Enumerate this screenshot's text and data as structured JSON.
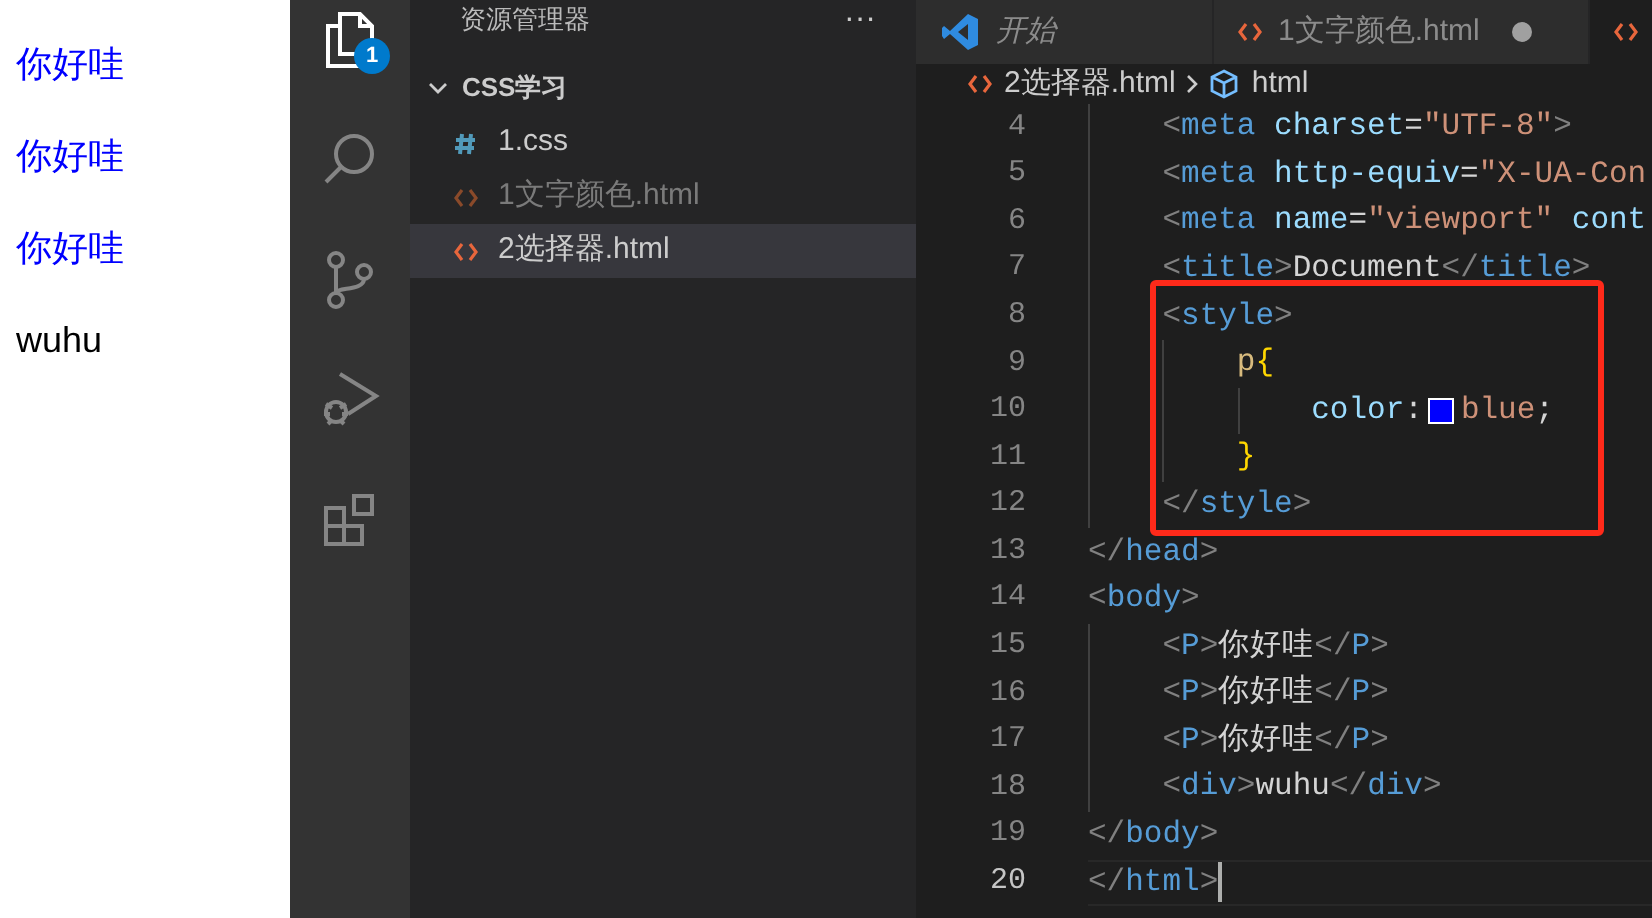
{
  "preview": {
    "items": [
      {
        "kind": "p",
        "text": "你好哇"
      },
      {
        "kind": "p",
        "text": "你好哇"
      },
      {
        "kind": "p",
        "text": "你好哇"
      },
      {
        "kind": "div",
        "text": "wuhu"
      }
    ]
  },
  "activity_bar": {
    "items": [
      {
        "selected": true,
        "badge": "1"
      },
      {
        "selected": false
      },
      {
        "selected": false
      },
      {
        "selected": false
      },
      {
        "selected": false
      }
    ]
  },
  "explorer": {
    "title": "资源管理器",
    "more": "···",
    "folder": {
      "name": "CSS学习",
      "expanded": true,
      "children": [
        {
          "name": "1.css",
          "kind": "css",
          "dimmed": false,
          "selected": false
        },
        {
          "name": "1文字颜色.html",
          "kind": "html",
          "dimmed": true,
          "selected": false
        },
        {
          "name": "2选择器.html",
          "kind": "html",
          "dimmed": false,
          "selected": true
        }
      ]
    }
  },
  "tabs": [
    {
      "kind": "welcome",
      "label": "开始",
      "modified": false,
      "selected": false
    },
    {
      "kind": "html",
      "label": "1文字颜色.html",
      "modified": true,
      "selected": false
    },
    {
      "kind": "html",
      "selected": true,
      "modified": false
    }
  ],
  "breadcrumb": [
    {
      "kind": "html",
      "label": "2选择器.html"
    },
    {
      "kind": "element",
      "label": "html"
    }
  ],
  "editor": {
    "lines": [
      {
        "number": "4",
        "current": false,
        "tokens": [
          {
            "kind": "punct",
            "text": "    <"
          },
          {
            "kind": "tag",
            "text": "meta "
          },
          {
            "kind": "attr",
            "text": "charset"
          },
          {
            "kind": "text",
            "text": "="
          },
          {
            "kind": "string",
            "text": "\"UTF-8\""
          },
          {
            "kind": "punct",
            "text": ">"
          }
        ]
      },
      {
        "number": "5",
        "current": false,
        "tokens": [
          {
            "kind": "punct",
            "text": "    <"
          },
          {
            "kind": "tag",
            "text": "meta "
          },
          {
            "kind": "attr",
            "text": "http-equiv"
          },
          {
            "kind": "text",
            "text": "="
          },
          {
            "kind": "string",
            "text": "\"X-UA-Con"
          }
        ]
      },
      {
        "number": "6",
        "current": false,
        "tokens": [
          {
            "kind": "punct",
            "text": "    <"
          },
          {
            "kind": "tag",
            "text": "meta "
          },
          {
            "kind": "attr",
            "text": "name"
          },
          {
            "kind": "text",
            "text": "="
          },
          {
            "kind": "string",
            "text": "\"viewport\" "
          },
          {
            "kind": "attr",
            "text": "cont"
          }
        ]
      },
      {
        "number": "7",
        "current": false,
        "tokens": [
          {
            "kind": "punct",
            "text": "    <"
          },
          {
            "kind": "tag",
            "text": "title"
          },
          {
            "kind": "punct",
            "text": ">"
          },
          {
            "kind": "text",
            "text": "Document"
          },
          {
            "kind": "punct",
            "text": "</"
          },
          {
            "kind": "tag",
            "text": "title"
          },
          {
            "kind": "punct",
            "text": ">"
          }
        ]
      },
      {
        "number": "8",
        "current": false,
        "tokens": [
          {
            "kind": "punct",
            "text": "    <"
          },
          {
            "kind": "tag",
            "text": "style"
          },
          {
            "kind": "punct",
            "text": ">"
          }
        ]
      },
      {
        "number": "9",
        "current": false,
        "tokens": [
          {
            "kind": "selector",
            "text": "        p"
          },
          {
            "kind": "brace",
            "text": "{"
          }
        ]
      },
      {
        "number": "10",
        "current": false,
        "tokens": [
          {
            "kind": "property",
            "text": "            color"
          },
          {
            "kind": "text",
            "text": ":"
          },
          {
            "kind": "swatch",
            "color": "#0000ff"
          },
          {
            "kind": "value",
            "text": "blue"
          },
          {
            "kind": "text",
            "text": ";"
          }
        ]
      },
      {
        "number": "11",
        "current": false,
        "tokens": [
          {
            "kind": "brace",
            "text": "        }"
          }
        ]
      },
      {
        "number": "12",
        "current": false,
        "tokens": [
          {
            "kind": "punct",
            "text": "    </"
          },
          {
            "kind": "tag",
            "text": "style"
          },
          {
            "kind": "punct",
            "text": ">"
          }
        ]
      },
      {
        "number": "13",
        "current": false,
        "tokens": [
          {
            "kind": "punct",
            "text": "</"
          },
          {
            "kind": "tag",
            "text": "head"
          },
          {
            "kind": "punct",
            "text": ">"
          }
        ]
      },
      {
        "number": "14",
        "current": false,
        "tokens": [
          {
            "kind": "punct",
            "text": "<"
          },
          {
            "kind": "tag",
            "text": "body"
          },
          {
            "kind": "punct",
            "text": ">"
          }
        ]
      },
      {
        "number": "15",
        "current": false,
        "tokens": [
          {
            "kind": "punct",
            "text": "    <"
          },
          {
            "kind": "tag",
            "text": "P"
          },
          {
            "kind": "punct",
            "text": ">"
          },
          {
            "kind": "text",
            "text": "你好哇"
          },
          {
            "kind": "punct",
            "text": "</"
          },
          {
            "kind": "tag",
            "text": "P"
          },
          {
            "kind": "punct",
            "text": ">"
          }
        ]
      },
      {
        "number": "16",
        "current": false,
        "tokens": [
          {
            "kind": "punct",
            "text": "    <"
          },
          {
            "kind": "tag",
            "text": "P"
          },
          {
            "kind": "punct",
            "text": ">"
          },
          {
            "kind": "text",
            "text": "你好哇"
          },
          {
            "kind": "punct",
            "text": "</"
          },
          {
            "kind": "tag",
            "text": "P"
          },
          {
            "kind": "punct",
            "text": ">"
          }
        ]
      },
      {
        "number": "17",
        "current": false,
        "tokens": [
          {
            "kind": "punct",
            "text": "    <"
          },
          {
            "kind": "tag",
            "text": "P"
          },
          {
            "kind": "punct",
            "text": ">"
          },
          {
            "kind": "text",
            "text": "你好哇"
          },
          {
            "kind": "punct",
            "text": "</"
          },
          {
            "kind": "tag",
            "text": "P"
          },
          {
            "kind": "punct",
            "text": ">"
          }
        ]
      },
      {
        "number": "18",
        "current": false,
        "tokens": [
          {
            "kind": "punct",
            "text": "    <"
          },
          {
            "kind": "tag",
            "text": "div"
          },
          {
            "kind": "punct",
            "text": ">"
          },
          {
            "kind": "text",
            "text": "wuhu"
          },
          {
            "kind": "punct",
            "text": "</"
          },
          {
            "kind": "tag",
            "text": "div"
          },
          {
            "kind": "punct",
            "text": ">"
          }
        ]
      },
      {
        "number": "19",
        "current": false,
        "tokens": [
          {
            "kind": "punct",
            "text": "</"
          },
          {
            "kind": "tag",
            "text": "body"
          },
          {
            "kind": "punct",
            "text": ">"
          }
        ]
      },
      {
        "number": "20",
        "current": true,
        "tokens": [
          {
            "kind": "punct",
            "text": "</"
          },
          {
            "kind": "tag",
            "text": "html"
          },
          {
            "kind": "punct",
            "text": ">"
          }
        ]
      }
    ]
  }
}
